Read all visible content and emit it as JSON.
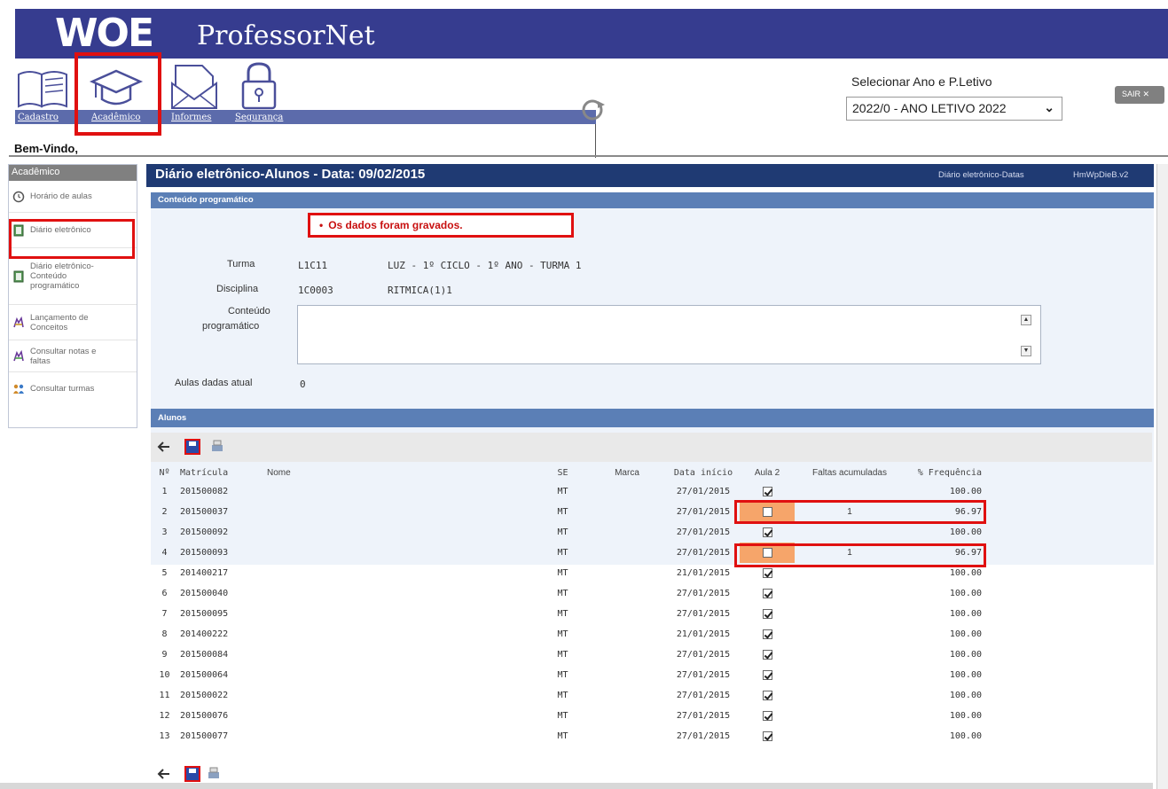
{
  "header": {
    "logo_text": "WOE",
    "app_name": "ProfessorNet",
    "menu": [
      {
        "label": "Cadastro"
      },
      {
        "label": "Acadêmico"
      },
      {
        "label": "Informes"
      },
      {
        "label": "Segurança"
      }
    ],
    "ano_label": "Selecionar Ano e P.Letivo",
    "ano_value": "2022/0 - ANO LETIVO 2022",
    "sair_label": "SAIR ✕",
    "welcome": "Bem-Vindo,"
  },
  "sidebar": {
    "title": "Acadêmico",
    "items": [
      {
        "label": "Horário de aulas",
        "icon": "clock-icon"
      },
      {
        "label": "Diário eletrônico",
        "icon": "book-icon"
      },
      {
        "label": "Diário eletrônico-Conteúdo programático",
        "icon": "book-icon"
      },
      {
        "label": "Lançamento de Conceitos",
        "icon": "pencil-icon"
      },
      {
        "label": "Consultar notas e faltas",
        "icon": "pencil-icon"
      },
      {
        "label": "Consultar turmas",
        "icon": "group-icon"
      }
    ]
  },
  "main": {
    "title": "Diário eletrônico-Alunos - Data: 09/02/2015",
    "link_datas": "Diário eletrônico-Datas",
    "program_code": "HmWpDieB.v2",
    "conteudo_header": "Conteúdo programático",
    "message": "Os dados foram gravados.",
    "fields": {
      "turma_label": "Turma",
      "turma_code": "L1C11",
      "turma_desc": "LUZ - 1º CICLO - 1º ANO - TURMA 1",
      "disciplina_label": "Disciplina",
      "disciplina_code": "1C0003",
      "disciplina_desc": "RITMICA(1)1",
      "conteudo_label_1": "Conteúdo",
      "conteudo_label_2": "programático",
      "aulas_label": "Aulas dadas atual",
      "aulas_value": "0"
    },
    "alunos_header": "Alunos",
    "columns": [
      "Nº",
      "Matrícula",
      "Nome",
      "SE",
      "Marca",
      "Data início",
      "Aula 2",
      "Faltas acumuladas",
      "% Frequência"
    ],
    "rows": [
      {
        "n": "1",
        "mat": "201500082",
        "se": "MT",
        "data": "27/01/2015",
        "aula2": true,
        "faltas": "",
        "freq": "100.00"
      },
      {
        "n": "2",
        "mat": "201500037",
        "se": "MT",
        "data": "27/01/2015",
        "aula2": false,
        "faltas": "1",
        "freq": "96.97"
      },
      {
        "n": "3",
        "mat": "201500092",
        "se": "MT",
        "data": "27/01/2015",
        "aula2": true,
        "faltas": "",
        "freq": "100.00"
      },
      {
        "n": "4",
        "mat": "201500093",
        "se": "MT",
        "data": "27/01/2015",
        "aula2": false,
        "faltas": "1",
        "freq": "96.97"
      },
      {
        "n": "5",
        "mat": "201400217",
        "se": "MT",
        "data": "21/01/2015",
        "aula2": true,
        "faltas": "",
        "freq": "100.00"
      },
      {
        "n": "6",
        "mat": "201500040",
        "se": "MT",
        "data": "27/01/2015",
        "aula2": true,
        "faltas": "",
        "freq": "100.00"
      },
      {
        "n": "7",
        "mat": "201500095",
        "se": "MT",
        "data": "27/01/2015",
        "aula2": true,
        "faltas": "",
        "freq": "100.00"
      },
      {
        "n": "8",
        "mat": "201400222",
        "se": "MT",
        "data": "21/01/2015",
        "aula2": true,
        "faltas": "",
        "freq": "100.00"
      },
      {
        "n": "9",
        "mat": "201500084",
        "se": "MT",
        "data": "27/01/2015",
        "aula2": true,
        "faltas": "",
        "freq": "100.00"
      },
      {
        "n": "10",
        "mat": "201500064",
        "se": "MT",
        "data": "27/01/2015",
        "aula2": true,
        "faltas": "",
        "freq": "100.00"
      },
      {
        "n": "11",
        "mat": "201500022",
        "se": "MT",
        "data": "27/01/2015",
        "aula2": true,
        "faltas": "",
        "freq": "100.00"
      },
      {
        "n": "12",
        "mat": "201500076",
        "se": "MT",
        "data": "27/01/2015",
        "aula2": true,
        "faltas": "",
        "freq": "100.00"
      },
      {
        "n": "13",
        "mat": "201500077",
        "se": "MT",
        "data": "27/01/2015",
        "aula2": true,
        "faltas": "",
        "freq": "100.00"
      }
    ]
  },
  "colors": {
    "brand": "#363c8f",
    "title_bar": "#1f3a73",
    "section": "#5b7fb6",
    "highlight": "#e01010",
    "absence_cell": "#f6a56a"
  }
}
